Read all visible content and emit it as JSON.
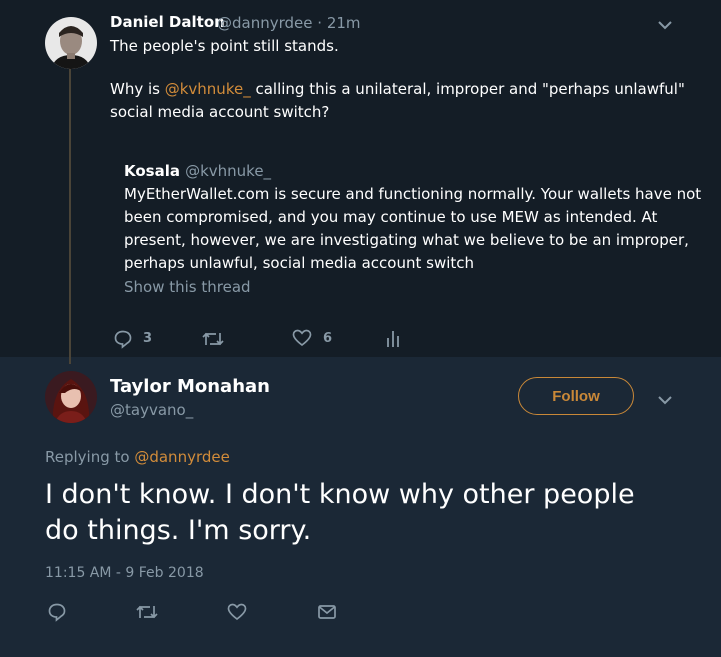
{
  "parent_tweet": {
    "author_name": "Daniel Dalton",
    "author_handle": "@dannyrdee",
    "separator": " · ",
    "time": "21m",
    "line1": "The people's point still stands.",
    "line2_prefix": "Why is ",
    "mention": "@kvhnuke_",
    "line2_suffix": " calling this a unilateral, improper and \"perhaps unlawful\"",
    "line3": "social media account switch?",
    "quoted": {
      "author_name": "Kosala",
      "author_handle": "@kvhnuke_",
      "lines": [
        "MyEtherWallet.com is secure and functioning normally. Your wallets have not",
        "been compromised, and you may continue to use MEW as intended. At",
        "present, however, we are investigating what we believe to be an improper,",
        "perhaps unlawful, social media account switch"
      ],
      "show_thread": "Show this thread"
    },
    "reply_count": "3",
    "like_count": "6"
  },
  "main_tweet": {
    "author_name": "Taylor Monahan",
    "author_handle": "@tayvano_",
    "follow_label": "Follow",
    "replying_prefix": "Replying to ",
    "replying_handle": "@dannyrdee",
    "text_line1": "I don't know. I don't know why other people",
    "text_line2": "do things. I'm sorry.",
    "timestamp": "11:15 AM - 9 Feb 2018"
  },
  "colors": {
    "accent": "#d28c3a",
    "muted": "#8899a6",
    "background_top": "#141d26",
    "background_bottom": "#1b2836"
  },
  "icons": [
    "chevron-down-icon",
    "reply-icon",
    "retweet-icon",
    "like-icon",
    "analytics-icon",
    "dm-icon"
  ]
}
